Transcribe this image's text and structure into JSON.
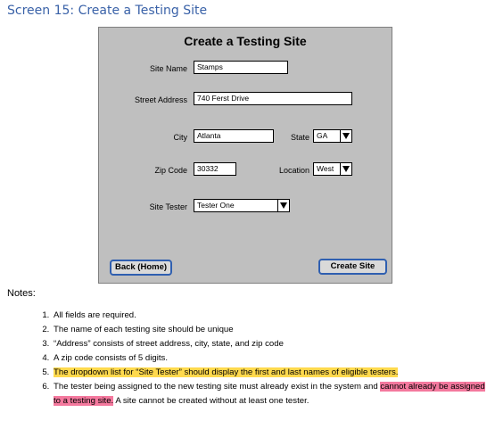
{
  "heading": "Screen 15: Create a Testing Site",
  "form": {
    "title": "Create a Testing Site",
    "site_name_label": "Site Name",
    "site_name_value": "Stamps",
    "street_label": "Street Address",
    "street_value": "740 Ferst Drive",
    "city_label": "City",
    "city_value": "Atlanta",
    "state_label": "State",
    "state_value": "GA",
    "zip_label": "Zip Code",
    "zip_value": "30332",
    "location_label": "Location",
    "location_value": "West",
    "tester_label": "Site Tester",
    "tester_value": "Tester One",
    "back_button": "Back (Home)",
    "create_button": "Create Site"
  },
  "notes": {
    "title": "Notes:",
    "items": [
      "All fields are required.",
      "The name of each testing site should be unique",
      "“Address” consists of street address, city, state, and zip code",
      "A zip code consists of 5 digits.",
      "The dropdown list for “Site Tester” should display the first and last names of eligible testers.",
      "The tester being assigned to the new testing site must already exist in the system and ",
      "cannot already be assigned to a testing site.",
      " A site cannot be created without at least one tester."
    ]
  },
  "colors": {
    "heading": "#3a62a8",
    "panel": "#bfbfbf",
    "button_border": "#2f5fb0",
    "highlight_yellow": "#ffd94d",
    "highlight_pink": "#f4799e"
  }
}
